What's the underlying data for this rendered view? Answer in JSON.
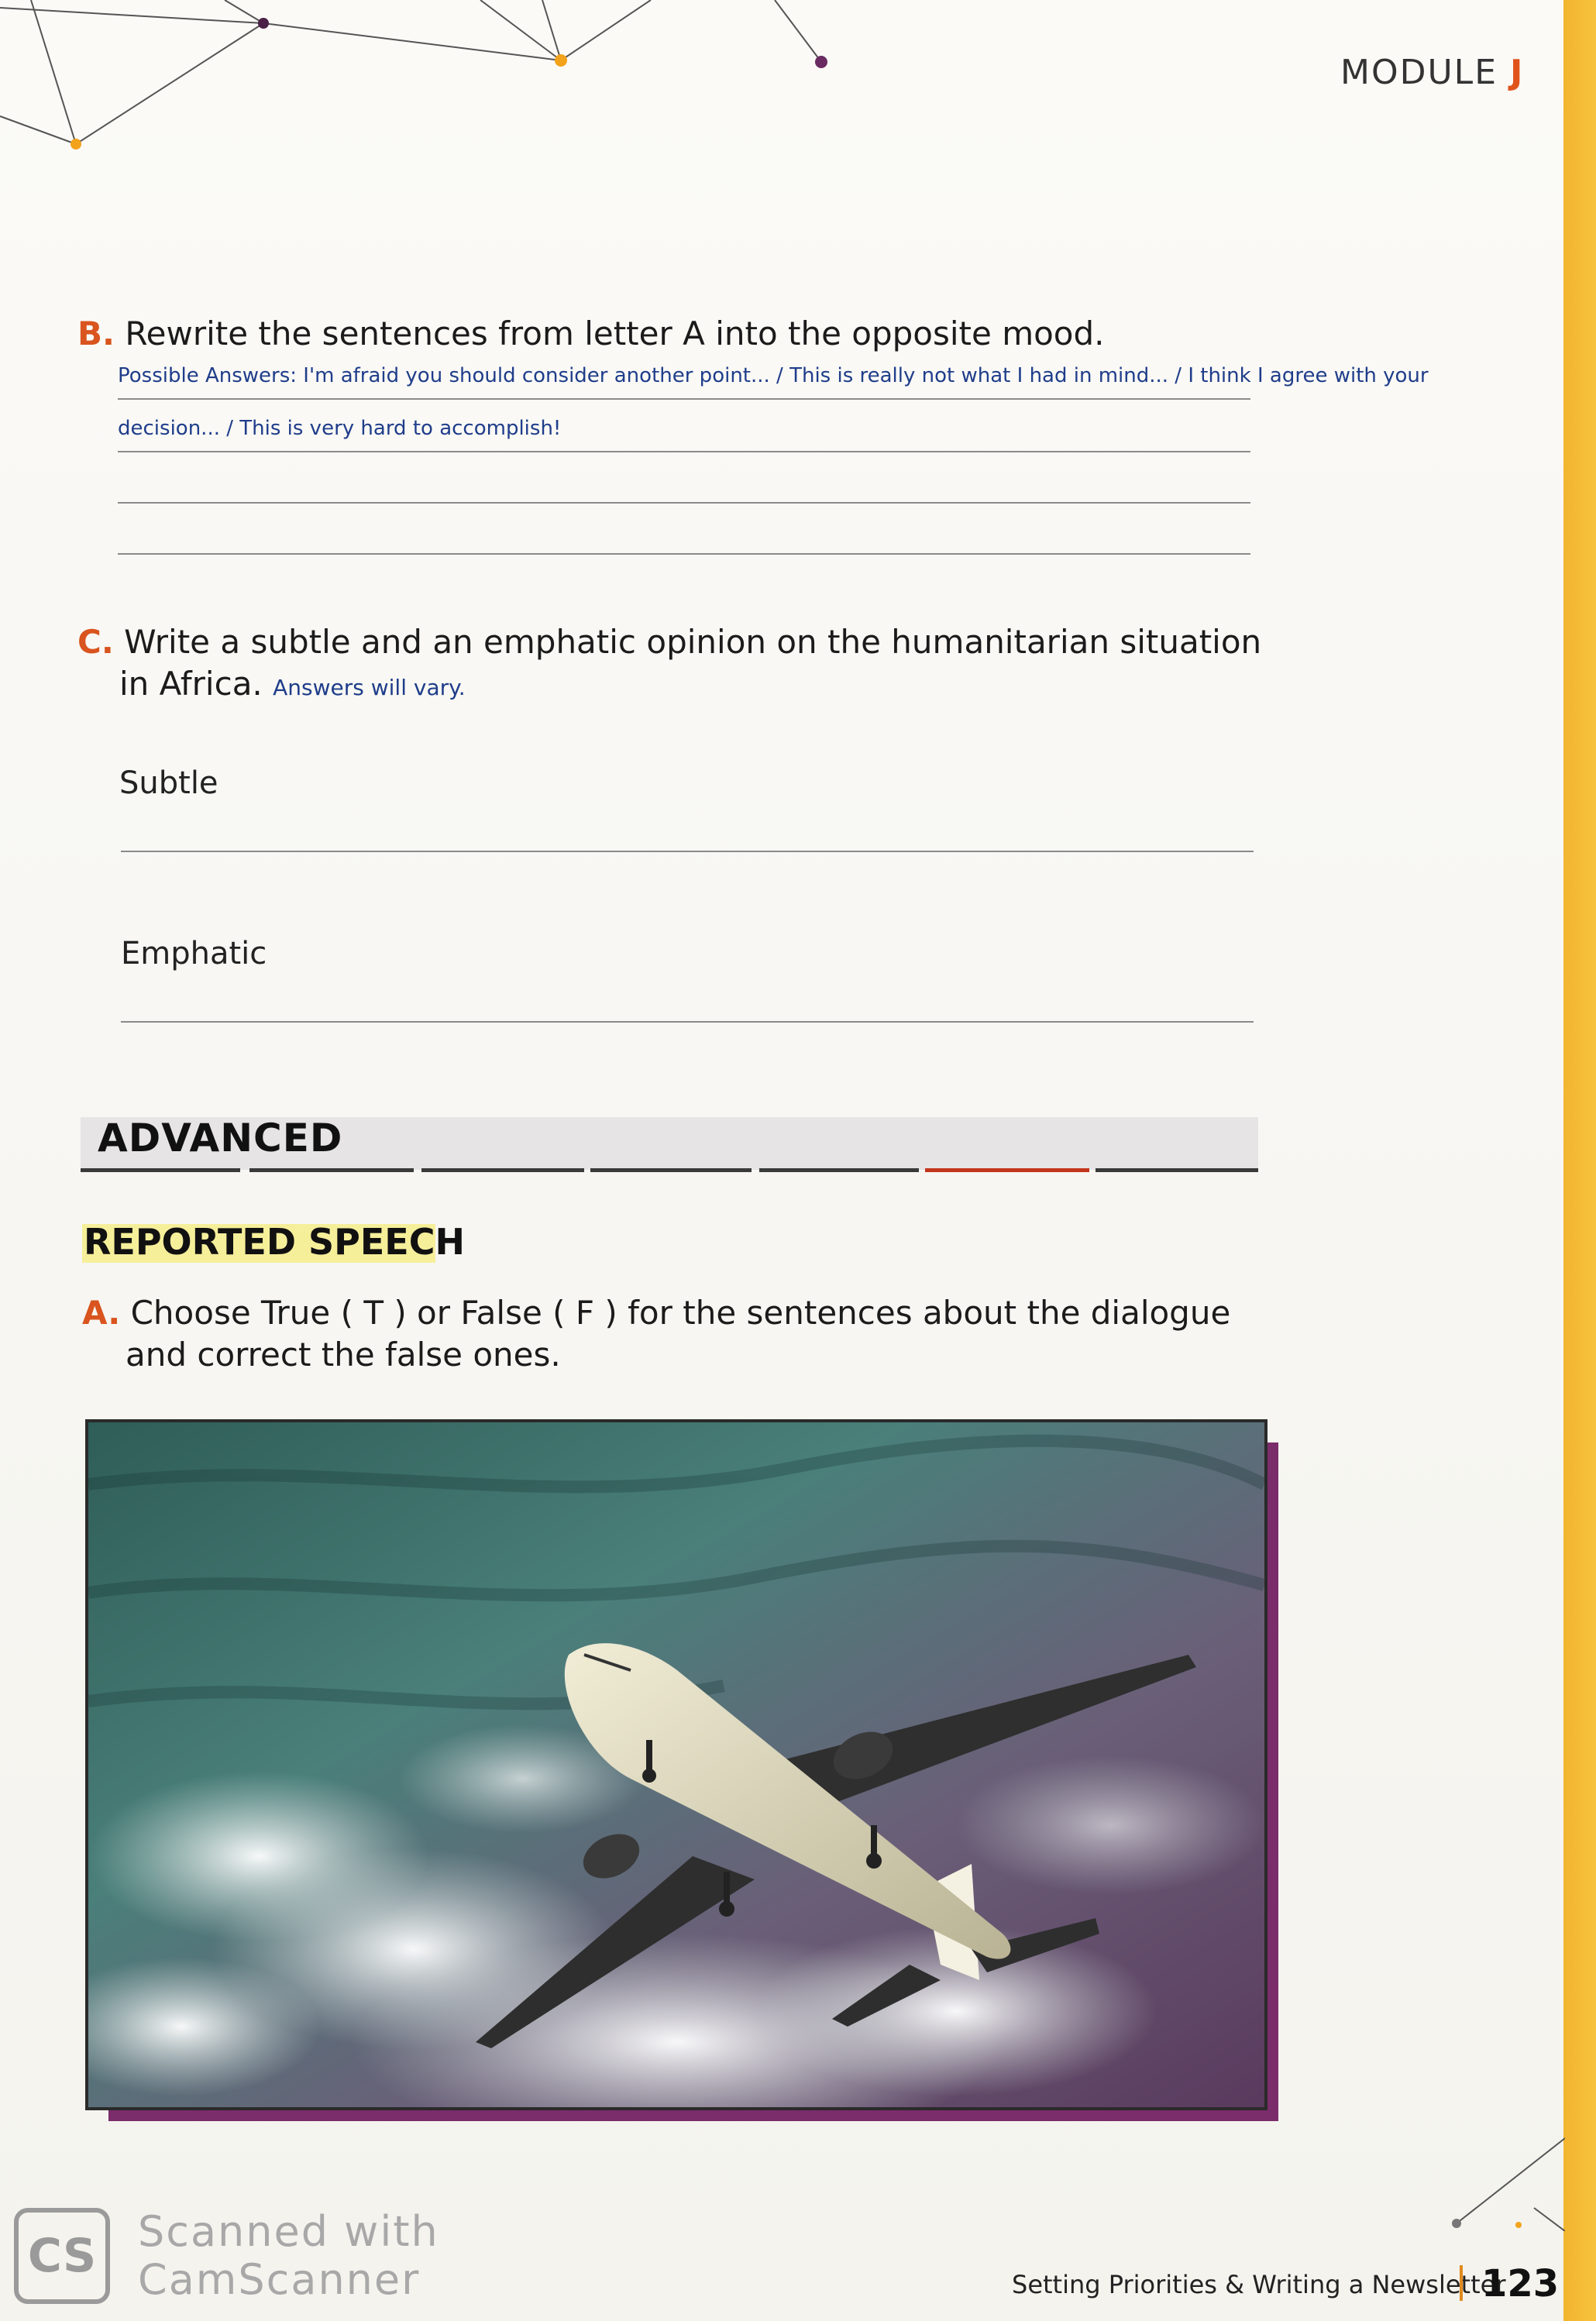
{
  "header": {
    "module_label": "MODULE",
    "module_letter": "J"
  },
  "section_b": {
    "letter": "B.",
    "prompt": "Rewrite the sentences from letter A into the opposite mood.",
    "answer_line1": "Possible Answers: I'm afraid you should consider another point... / This is really not what I had in mind... / I think I agree with your",
    "answer_line2": "decision... / This is very hard to accomplish!"
  },
  "section_c": {
    "letter": "C.",
    "prompt_line1": "Write a subtle and an emphatic opinion on the humanitarian situation",
    "prompt_line2": "in Africa.",
    "answer_note": "Answers will vary.",
    "subtle_label": "Subtle",
    "emphatic_label": "Emphatic"
  },
  "advanced": {
    "title": "ADVANCED"
  },
  "reported_speech": {
    "title": "REPORTED SPEECH",
    "a_letter": "A.",
    "a_prompt_line1": "Choose True ( T ) or False ( F ) for the sentences about the dialogue",
    "a_prompt_line2": "and correct the false ones."
  },
  "photo": {
    "subject": "airplane-in-cloudy-sky"
  },
  "footer": {
    "chapter": "Setting Priorities & Writing a Newsletter",
    "page_number": "123"
  },
  "watermark": {
    "logo": "CS",
    "line1": "Scanned with",
    "line2": "CamScanner"
  },
  "colors": {
    "accent_orange": "#d9541e",
    "answer_blue": "#1f3d8a",
    "photo_frame": "#7b2c6b",
    "strip": "#f2b530"
  }
}
